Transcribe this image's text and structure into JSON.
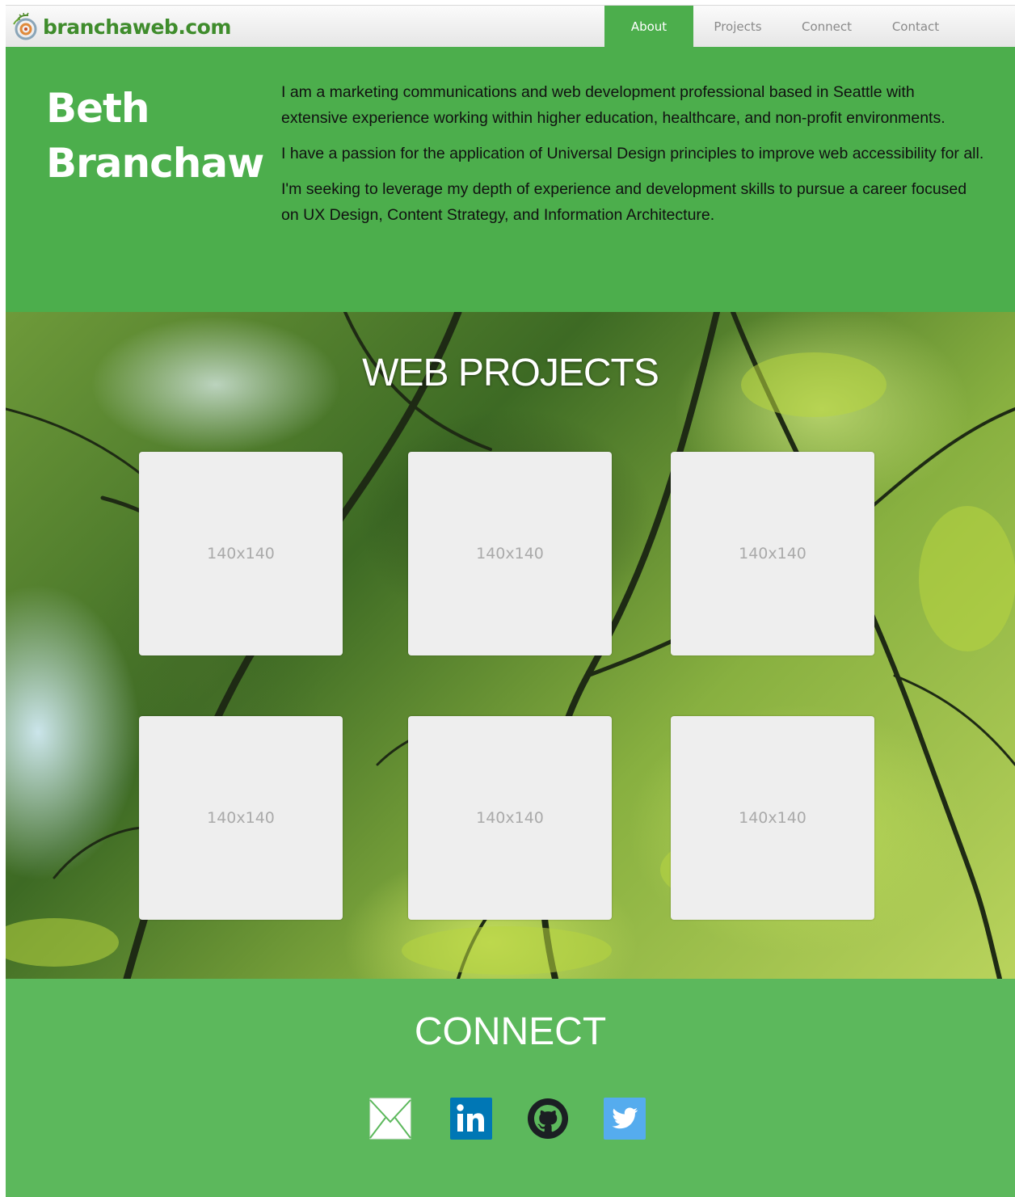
{
  "brand": {
    "name": "branchaweb.com",
    "logo_icon": "branch-swirl-logo"
  },
  "nav": {
    "items": [
      {
        "label": "About",
        "active": true
      },
      {
        "label": "Projects",
        "active": false
      },
      {
        "label": "Connect",
        "active": false
      },
      {
        "label": "Contact",
        "active": false
      }
    ]
  },
  "about": {
    "name_line1": "Beth",
    "name_line2": "Branchaw",
    "paragraphs": [
      "I am a marketing communications and web development professional based in Seattle with extensive experience working within higher education, healthcare, and non-profit environments.",
      "I have a passion for the application of Universal Design principles to improve web accessibility for all.",
      "I'm seeking to leverage my depth of experience and development skills to pursue a career focused on UX Design, Content Strategy, and Information Architecture."
    ]
  },
  "projects": {
    "title": "WEB PROJECTS",
    "thumbnails": [
      "140x140",
      "140x140",
      "140x140",
      "140x140",
      "140x140",
      "140x140"
    ]
  },
  "connect": {
    "title": "CONNECT",
    "icons": [
      "email-icon",
      "linkedin-icon",
      "github-icon",
      "twitter-icon"
    ]
  },
  "colors": {
    "primary_green": "#4cae4c",
    "connect_green": "#5cb85c",
    "linkedin_blue": "#0077b5",
    "twitter_blue": "#55acee"
  }
}
